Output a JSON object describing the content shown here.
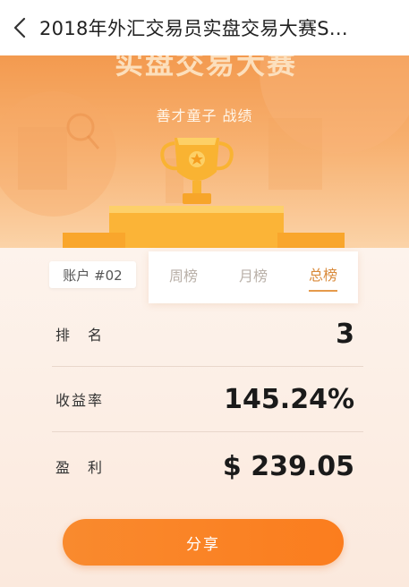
{
  "header": {
    "title": "2018年外汇交易员实盘交易大赛S..."
  },
  "hero": {
    "banner_text": "实盘交易大赛",
    "subtitle": "善才童子 战绩"
  },
  "account": {
    "label": "账户 #02"
  },
  "tabs": [
    {
      "label": "周榜",
      "active": false
    },
    {
      "label": "月榜",
      "active": false
    },
    {
      "label": "总榜",
      "active": true
    }
  ],
  "stats": {
    "rank": {
      "label": "排　名",
      "value": "3"
    },
    "return_rate": {
      "label": "收益率",
      "value": "145.24%"
    },
    "profit": {
      "label": "盈　利",
      "value": "$ 239.05"
    }
  },
  "actions": {
    "share_label": "分享"
  },
  "colors": {
    "accent": "#f98a2e",
    "active_tab": "#d98a3a"
  }
}
